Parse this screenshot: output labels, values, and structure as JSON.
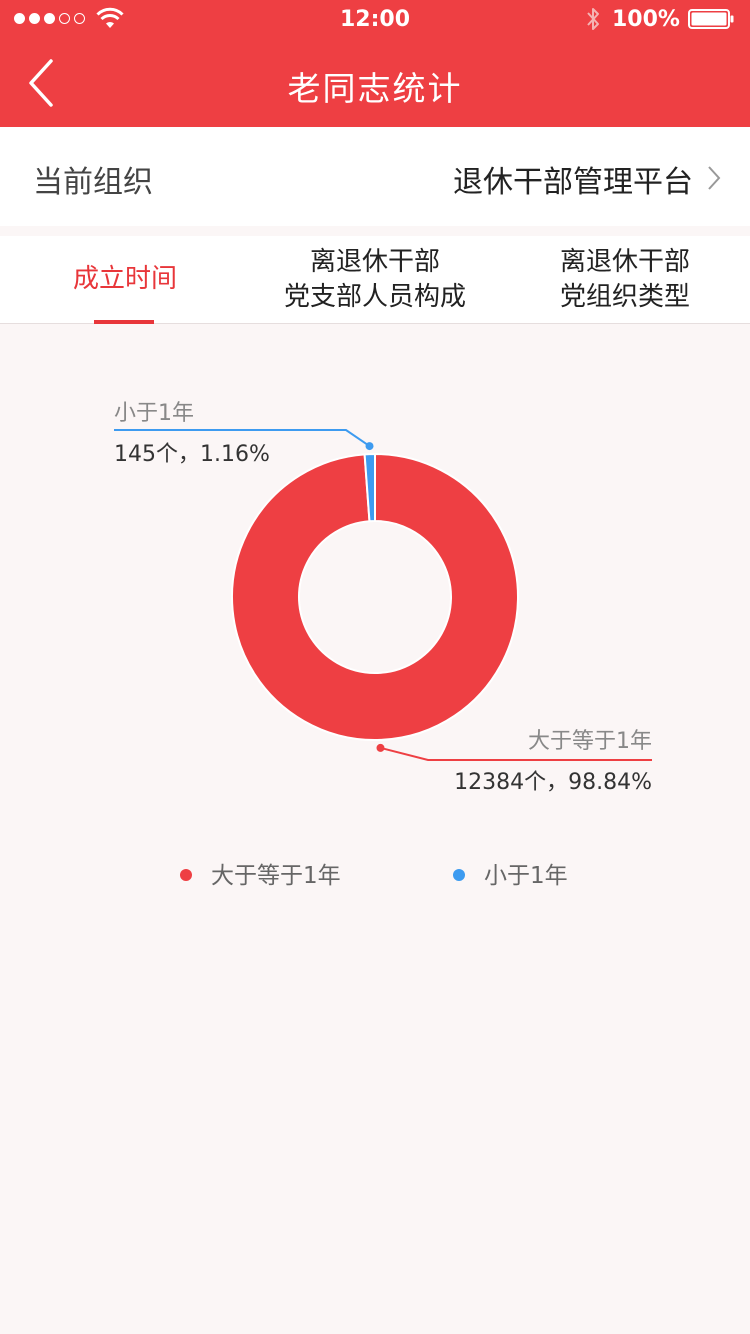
{
  "status_bar": {
    "time": "12:00",
    "battery": "100%"
  },
  "header": {
    "title": "老同志统计"
  },
  "org": {
    "label": "当前组织",
    "value": "退休干部管理平台"
  },
  "tabs": [
    {
      "label": "成立时间",
      "active": true
    },
    {
      "label": "离退休干部\n党支部人员构成",
      "active": false
    },
    {
      "label": "离退休干部\n党组织类型",
      "active": false
    }
  ],
  "colors": {
    "accent": "#ee3f43",
    "blue": "#3d9bf0",
    "background": "#fbf6f6"
  },
  "chart_data": {
    "type": "pie",
    "style": "donut",
    "title": "",
    "slices": [
      {
        "name": "大于等于1年",
        "value": 12384,
        "percent": 98.84,
        "label": "大于等于1年",
        "detail": "12384个，98.84%",
        "color": "#ee3f43"
      },
      {
        "name": "小于1年",
        "value": 145,
        "percent": 1.16,
        "label": "小于1年",
        "detail": "145个，1.16%",
        "color": "#3d9bf0"
      }
    ],
    "legend": {
      "placement": "bottom",
      "items": [
        {
          "name": "大于等于1年",
          "color": "#ee3f43"
        },
        {
          "name": "小于1年",
          "color": "#3d9bf0"
        }
      ]
    }
  }
}
